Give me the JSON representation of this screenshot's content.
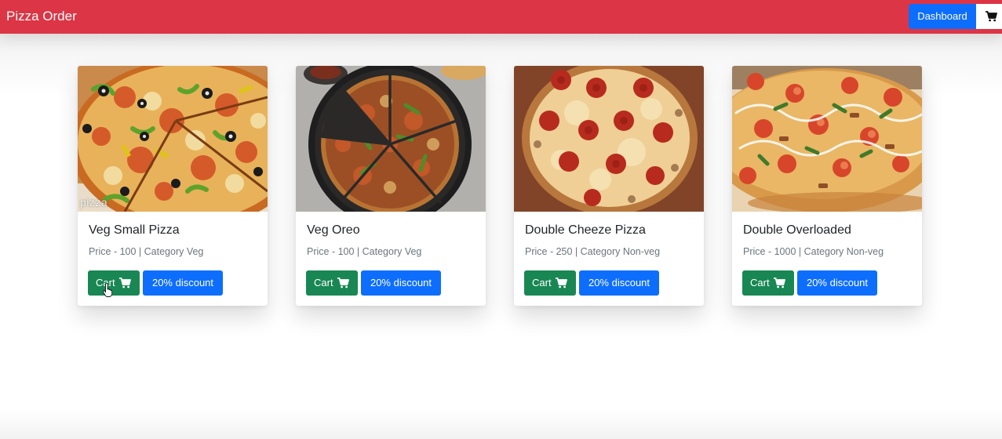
{
  "navbar": {
    "brand": "Pizza Order",
    "dashboard_label": "Dashboard",
    "cart_icon": "shopping-cart-icon",
    "color": "#dc3545"
  },
  "products": [
    {
      "title": "Veg Small Pizza",
      "price": "Price - 100 | Category Veg",
      "cart_label": "Cart",
      "discount_label": "20% discount",
      "image_watermark": "pizza"
    },
    {
      "title": "Veg Oreo",
      "price": "Price - 100 | Category Veg",
      "cart_label": "Cart",
      "discount_label": "20% discount"
    },
    {
      "title": "Double Cheeze Pizza",
      "price": "Price - 250 | Category Non-veg",
      "cart_label": "Cart",
      "discount_label": "20% discount"
    },
    {
      "title": "Double Overloaded",
      "price": "Price - 1000 | Category Non-veg",
      "cart_label": "Cart",
      "discount_label": "20% discount"
    }
  ],
  "colors": {
    "cart_button": "#198754",
    "discount_button": "#0d6efd",
    "dashboard_button": "#0d6efd"
  }
}
